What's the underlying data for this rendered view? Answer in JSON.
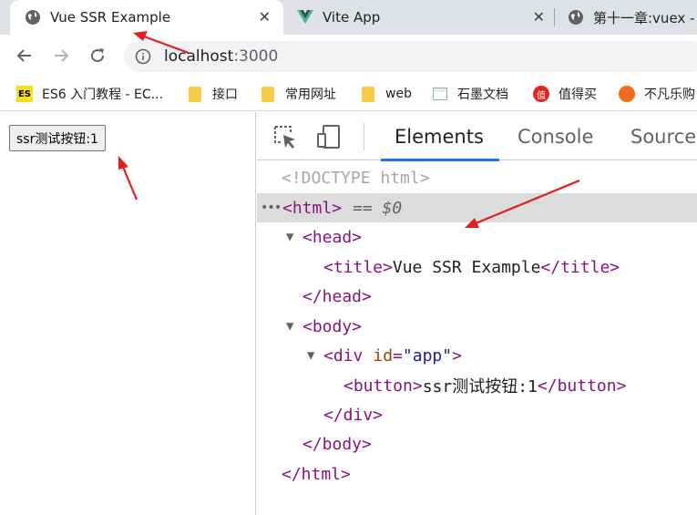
{
  "tabs": [
    {
      "title": "Vue SSR Example",
      "icon": "globe-icon",
      "active": true,
      "close": "✕"
    },
    {
      "title": "Vite App",
      "icon": "vue-icon",
      "active": false,
      "close": "✕"
    },
    {
      "title": "第十一章:vuex -",
      "icon": "globe-icon",
      "active": false
    }
  ],
  "toolbar": {
    "back": "←",
    "forward": "→",
    "reload": "↻",
    "url_host": "localhost",
    "url_port": ":3000"
  },
  "bookmarks": [
    {
      "label": "ES6 入门教程 - EC...",
      "icon": "es-icon",
      "icon_text": "ES"
    },
    {
      "label": "接口",
      "icon": "folder-icon"
    },
    {
      "label": "常用网址",
      "icon": "folder-icon"
    },
    {
      "label": "web",
      "icon": "folder-icon"
    },
    {
      "label": "石墨文档",
      "icon": "doc-icon"
    },
    {
      "label": "值得买",
      "icon": "red-circle-icon",
      "icon_text": "值"
    },
    {
      "label": "不凡乐购",
      "icon": "orange-circle-icon"
    }
  ],
  "page": {
    "button_label": "ssr测试按钮:1"
  },
  "devtools": {
    "tabs": [
      "Elements",
      "Console",
      "Sources"
    ],
    "active_tab": "Elements",
    "dom": {
      "doctype": "<!DOCTYPE html>",
      "html_open": "<html>",
      "selected_marker": "== $0",
      "head_open": "<head>",
      "title_open": "<title>",
      "title_text": "Vue SSR Example",
      "title_close": "</title>",
      "head_close": "</head>",
      "body_open": "<body>",
      "div_tag_start": "<div",
      "div_attr_name": "id",
      "div_attr_value": "\"app\"",
      "div_tag_end": ">",
      "button_open": "<button>",
      "button_text": "ssr测试按钮:1",
      "button_close": "</button>",
      "div_close": "</div>",
      "body_close": "</body>",
      "html_close": "</html>"
    }
  },
  "colors": {
    "annotation_red": "#e0201b",
    "tab_strip": "#dee1e6",
    "devtools_active_underline": "#1a73e8",
    "tag_color": "#881280"
  }
}
